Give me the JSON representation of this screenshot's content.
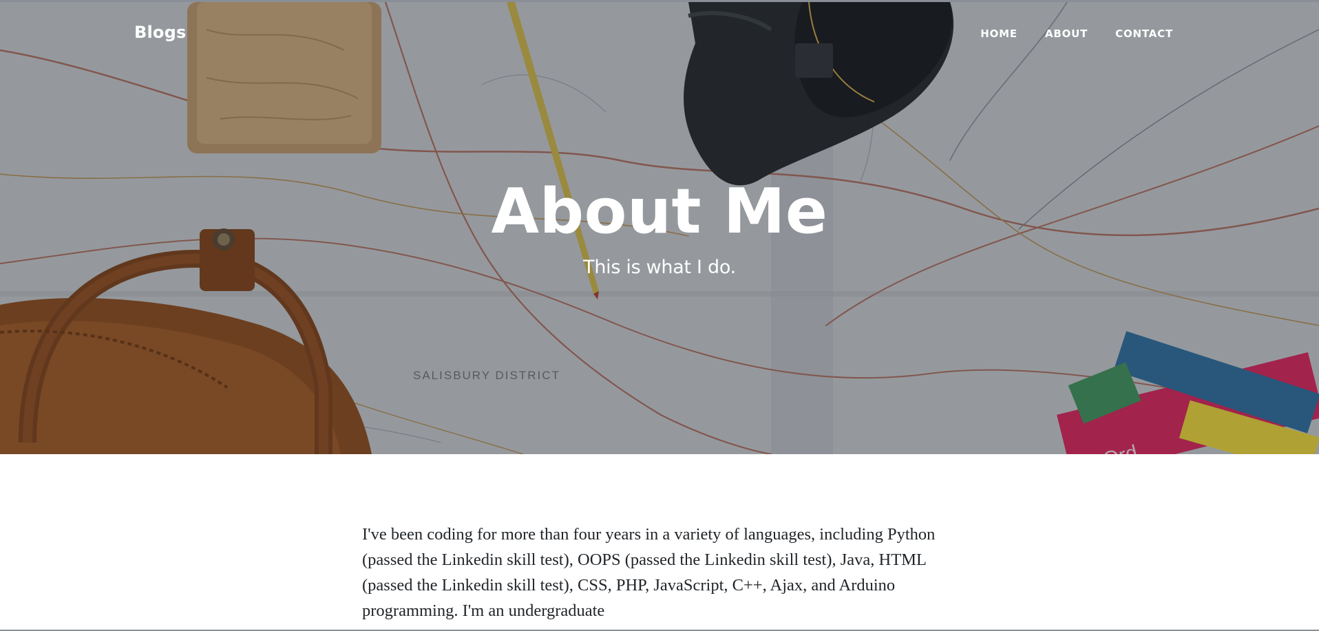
{
  "navbar": {
    "brand": "Blogs",
    "links": [
      {
        "label": "HOME"
      },
      {
        "label": "ABOUT"
      },
      {
        "label": "CONTACT"
      }
    ]
  },
  "hero": {
    "title": "About Me",
    "subtitle": "This is what I do."
  },
  "content": {
    "bio": "I've been coding for more than four years in a variety of languages, including Python (passed the Linkedin skill test), OOPS (passed the Linkedin skill test), Java, HTML (passed the Linkedin skill test), CSS, PHP, JavaScript, C++, Ajax, and Arduino programming. I'm an undergraduate"
  },
  "theme": {
    "text_color": "#212529",
    "hero_text_color": "#ffffff",
    "overlay_color": "#212529"
  }
}
